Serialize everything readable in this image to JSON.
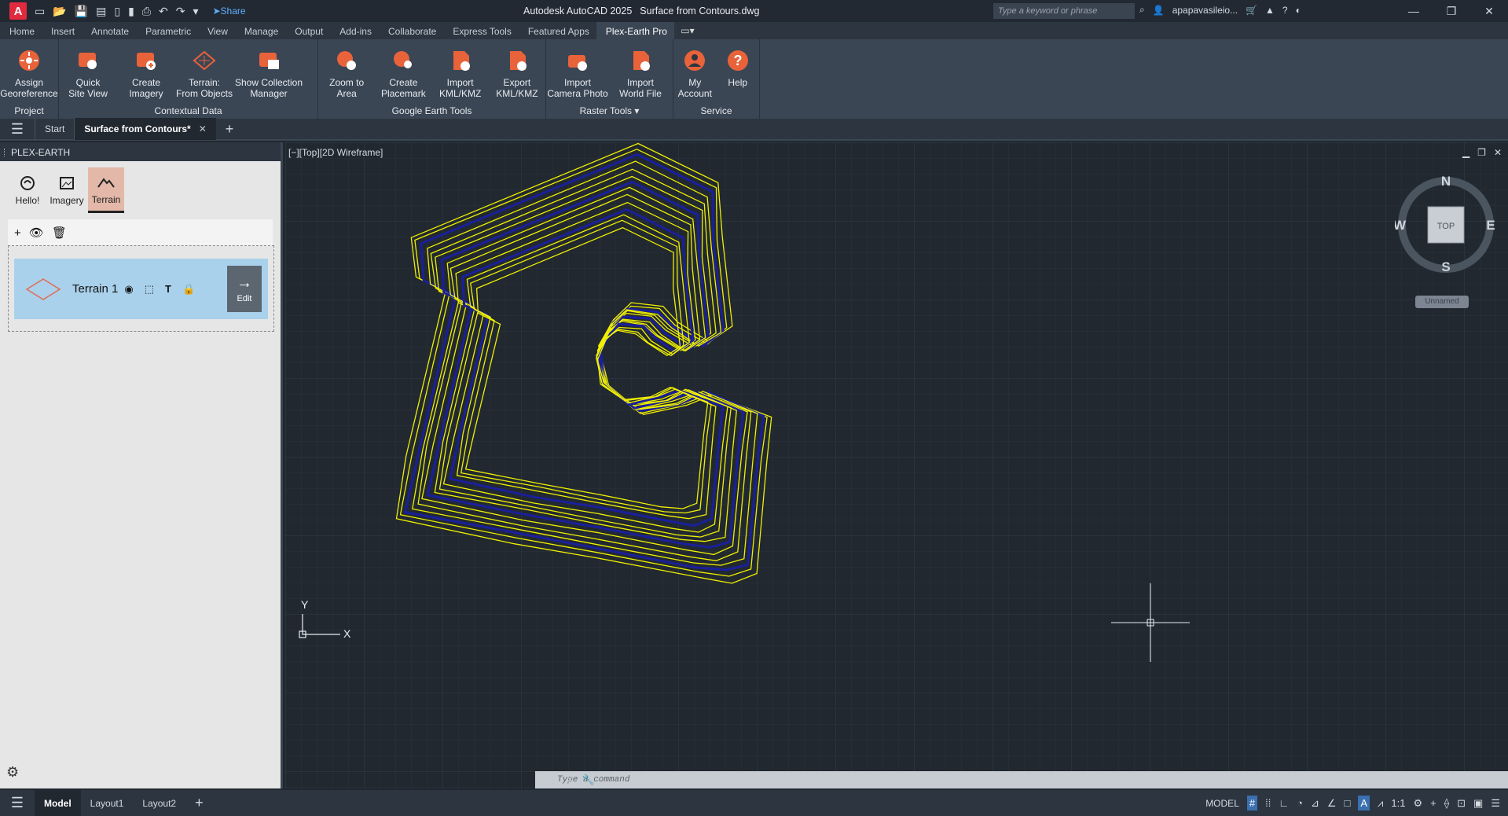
{
  "app": {
    "logo": "A",
    "title": "Autodesk AutoCAD 2025",
    "document": "Surface from Contours.dwg",
    "share_label": "Share",
    "search_placeholder": "Type a keyword or phrase",
    "user": "apapavasileio..."
  },
  "ribbon_tabs": [
    "Home",
    "Insert",
    "Annotate",
    "Parametric",
    "View",
    "Manage",
    "Output",
    "Add-ins",
    "Collaborate",
    "Express Tools",
    "Featured Apps",
    "Plex-Earth Pro"
  ],
  "ribbon_active_tab": "Plex-Earth Pro",
  "ribbon": {
    "project": {
      "title": "Project",
      "buttons": [
        {
          "line1": "Assign",
          "line2": "Georeference"
        }
      ]
    },
    "contextual": {
      "title": "Contextual Data",
      "buttons": [
        {
          "line1": "Quick",
          "line2": "Site View"
        },
        {
          "line1": "Create",
          "line2": "Imagery"
        },
        {
          "line1": "Terrain:",
          "line2": "From Objects"
        },
        {
          "line1": "Show Collection",
          "line2": "Manager"
        }
      ]
    },
    "google": {
      "title": "Google Earth Tools",
      "buttons": [
        {
          "line1": "Zoom to",
          "line2": "Area"
        },
        {
          "line1": "Create",
          "line2": "Placemark"
        },
        {
          "line1": "Import",
          "line2": "KML/KMZ"
        },
        {
          "line1": "Export",
          "line2": "KML/KMZ"
        }
      ]
    },
    "raster": {
      "title": "Raster Tools",
      "buttons": [
        {
          "line1": "Import",
          "line2": "Camera Photo"
        },
        {
          "line1": "Import",
          "line2": "World File"
        }
      ]
    },
    "service": {
      "title": "Service",
      "buttons": [
        {
          "line1": "My",
          "line2": "Account"
        },
        {
          "line1": "Help",
          "line2": ""
        }
      ]
    }
  },
  "file_tabs": {
    "start": "Start",
    "active": "Surface from Contours*"
  },
  "palette": {
    "title": "PLEX-EARTH",
    "tabs": [
      "Hello!",
      "Imagery",
      "Terrain"
    ],
    "terrain_name": "Terrain 1",
    "edit_label": "Edit"
  },
  "viewport": {
    "label": "[−][Top][2D Wireframe]",
    "compass": {
      "n": "N",
      "s": "S",
      "e": "E",
      "w": "W",
      "cube": "TOP"
    },
    "ucs_name": "Unnamed",
    "axis_x": "X",
    "axis_y": "Y",
    "command_placeholder": "Type a command"
  },
  "status": {
    "layout_tabs": [
      "Model",
      "Layout1",
      "Layout2"
    ],
    "model_label": "MODEL",
    "scale": "1:1"
  },
  "colors": {
    "contour": "#f0f000",
    "contour_fill": "#1a1f9a",
    "ribbon_icon": "#e8623a"
  }
}
